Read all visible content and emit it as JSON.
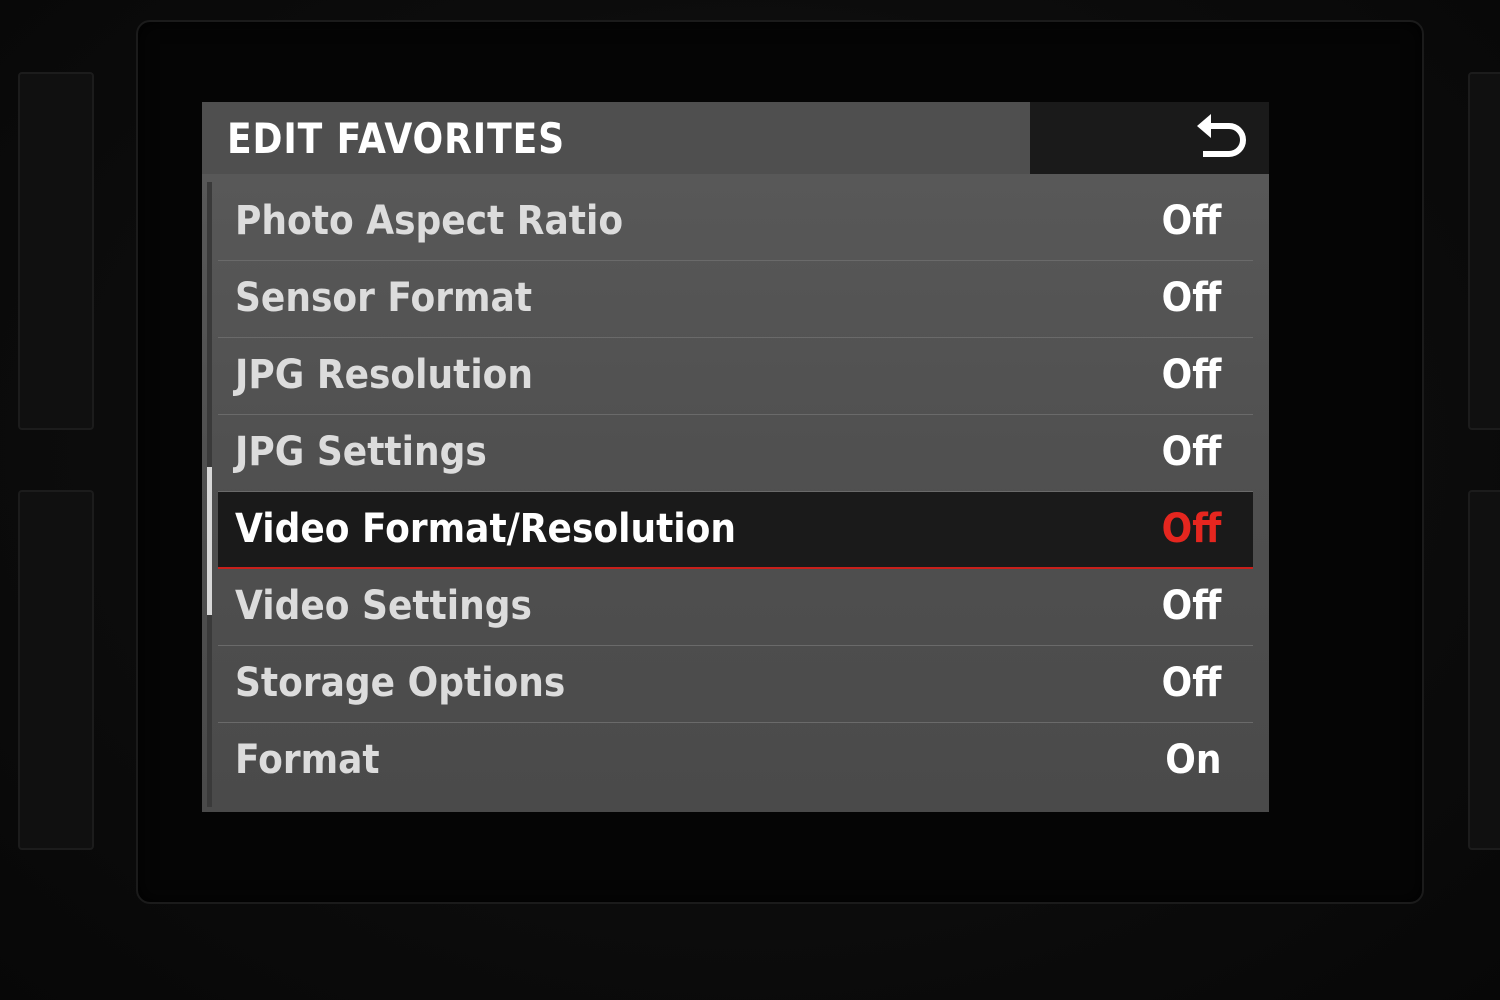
{
  "header": {
    "title": "EDIT FAVORITES",
    "back_icon": "return-arrow-icon"
  },
  "menu": {
    "selected_index": 4,
    "items": [
      {
        "label": "Photo Aspect Ratio",
        "value": "Off"
      },
      {
        "label": "Sensor Format",
        "value": "Off"
      },
      {
        "label": "JPG Resolution",
        "value": "Off"
      },
      {
        "label": "JPG Settings",
        "value": "Off"
      },
      {
        "label": "Video Format/Resolution",
        "value": "Off"
      },
      {
        "label": "Video Settings",
        "value": "Off"
      },
      {
        "label": "Storage Options",
        "value": "Off"
      },
      {
        "label": "Format",
        "value": "On"
      }
    ]
  },
  "colors": {
    "accent_red": "#e5261f",
    "selected_row_bg": "#1a1a1a",
    "screen_bg": "#555555",
    "text": "#ffffff"
  }
}
